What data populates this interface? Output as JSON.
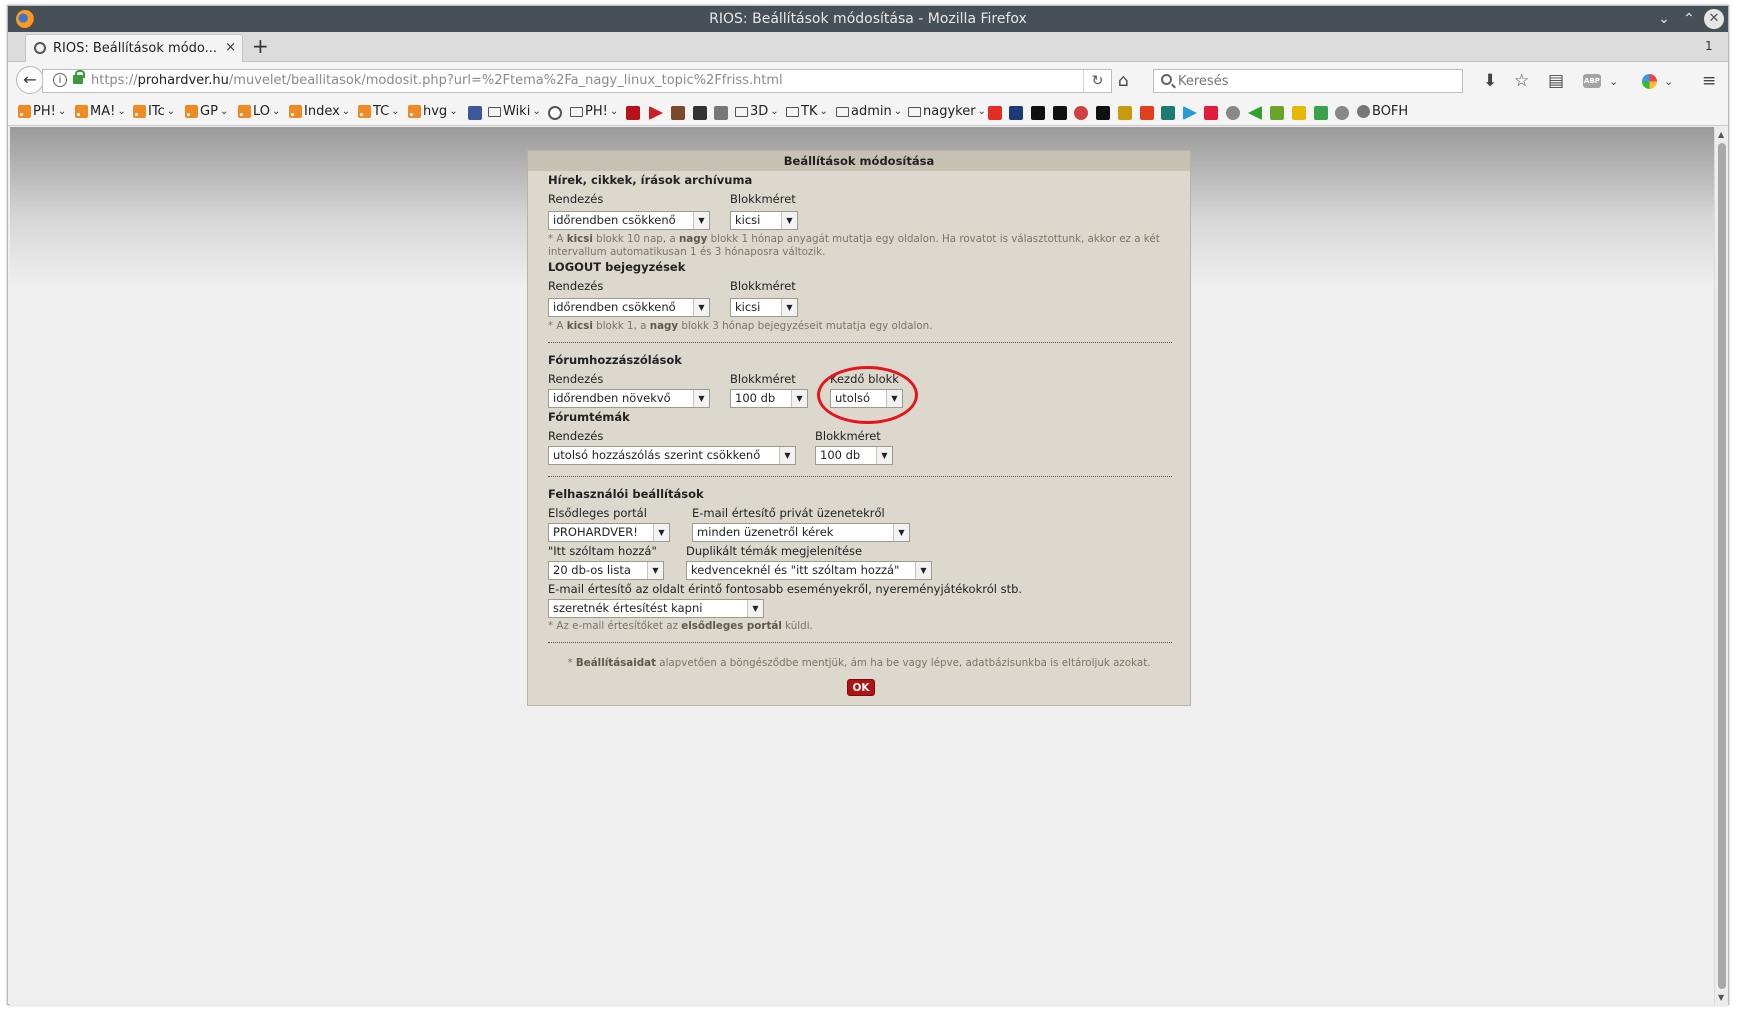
{
  "window": {
    "title": "RIOS: Beállítások módosítása - Mozilla Firefox",
    "controls": {
      "minimize": "⌄",
      "maximize": "⌃",
      "close": "✕"
    }
  },
  "tabs": {
    "active_title": "RIOS: Beállítások módo...",
    "close": "×",
    "new_tab": "+",
    "count": "1"
  },
  "nav": {
    "back": "←",
    "url_prefix": "https://",
    "url_host": "prohardver.hu",
    "url_path": "/muvelet/beallitasok/modosit.php?url=%2Ftema%2Fa_nagy_linux_topic%2Ffriss.html",
    "reload": "↻",
    "home": "⌂",
    "search_placeholder": "Keresés",
    "download": "⬇",
    "bookmark": "☆",
    "library": "▤",
    "abp": "ABP",
    "menu": "≡",
    "info": "i"
  },
  "bookmarks": [
    {
      "label": "PH!",
      "type": "rss"
    },
    {
      "label": "MA!",
      "type": "rss"
    },
    {
      "label": "ITc",
      "type": "rss"
    },
    {
      "label": "GP",
      "type": "rss"
    },
    {
      "label": "LO",
      "type": "rss"
    },
    {
      "label": "Index",
      "type": "rss"
    },
    {
      "label": "TC",
      "type": "rss"
    },
    {
      "label": "hvg",
      "type": "rss"
    },
    {
      "label": "Wiki",
      "type": "folder"
    },
    {
      "label": "PH!",
      "type": "folder"
    },
    {
      "label": "3D",
      "type": "folder"
    },
    {
      "label": "TK",
      "type": "folder"
    },
    {
      "label": "admin",
      "type": "folder"
    },
    {
      "label": "nagyker",
      "type": "folder"
    },
    {
      "label": "BOFH",
      "type": "globe"
    }
  ],
  "bookmark_icon_colors": [
    "#3b5998",
    "#555555",
    "#b8121b",
    "#cc1f1f",
    "#7b4a2a",
    "#333333",
    "#777777",
    "#e52d27",
    "#1b3a78",
    "#111111",
    "#111111",
    "#d04040",
    "#111111",
    "#c89a10",
    "#e04020",
    "#1e7b73",
    "#2a9ad8",
    "#e0203a",
    "#888888",
    "#30a030",
    "#6aa52a",
    "#e6b800",
    "#3aa34a",
    "#888888"
  ],
  "panel": {
    "header": "Beállítások módosítása",
    "section1": {
      "title": "Hírek, cikkek, írások archívuma",
      "sort_label": "Rendezés",
      "sort_value": "időrendben csökkenő",
      "block_label": "Blokkméret",
      "block_value": "kicsi",
      "note_prefix": "* A ",
      "note_b1": "kicsi",
      "note_mid": " blokk 10 nap, a ",
      "note_b2": "nagy",
      "note_rest": " blokk 1 hónap anyagát mutatja egy oldalon. Ha rovatot is választottunk, akkor ez a két",
      "note_line2": "intervallum automatikusan 1 és 3 hónaposra változik."
    },
    "section2": {
      "title": "LOGOUT bejegyzések",
      "sort_label": "Rendezés",
      "sort_value": "időrendben csökkenő",
      "block_label": "Blokkméret",
      "block_value": "kicsi",
      "note_prefix": "* A ",
      "note_b1": "kicsi",
      "note_mid": " blokk 1, a ",
      "note_b2": "nagy",
      "note_rest": " blokk 3 hónap bejegyzéseit mutatja egy oldalon."
    },
    "section3": {
      "title": "Fórumhozzászólások",
      "sort_label": "Rendezés",
      "sort_value": "időrendben növekvő",
      "block_label": "Blokkméret",
      "block_value": "100 db",
      "start_label": "Kezdő blokk",
      "start_value": "utolsó"
    },
    "section4": {
      "title": "Fórumtémák",
      "sort_label": "Rendezés",
      "sort_value": "utolsó hozzászólás szerint csökkenő",
      "block_label": "Blokkméret",
      "block_value": "100 db"
    },
    "section5": {
      "title": "Felhasználói beállítások",
      "portal_label": "Elsődleges portál",
      "portal_value": "PROHARDVER!",
      "email_private_label": "E-mail értesítő privát üzenetekről",
      "email_private_value": "minden üzenetről kérek",
      "itt_label": "\"Itt szóltam hozzá\"",
      "itt_value": "20 db-os lista",
      "dup_label": "Duplikált témák megjelenítése",
      "dup_value": "kedvenceknél és \"itt szóltam hozzá\"",
      "email_events_label": "E-mail értesítő az oldalt érintő fontosabb eseményekről, nyereményjátékokról stb.",
      "email_events_value": "szeretnék értesítést kapni",
      "note_prefix": "* Az e-mail értesítőket az ",
      "note_b": "elsődleges portál",
      "note_rest": " küldi."
    },
    "footer": {
      "note_prefix": "* ",
      "note_b": "Beállításaidat",
      "note_rest": " alapvetően a böngésződbe mentjük, ám ha be vagy lépve, adatbázisunkba is eltároljuk azokat.",
      "ok": "OK"
    },
    "dropdown_arrow": "▼"
  },
  "colors": {
    "titlebar": "#475057",
    "panel_bg": "#dcd8ce",
    "panel_header": "#c7c1b3",
    "ok_button": "#b01313",
    "annotation": "#e8141a"
  }
}
